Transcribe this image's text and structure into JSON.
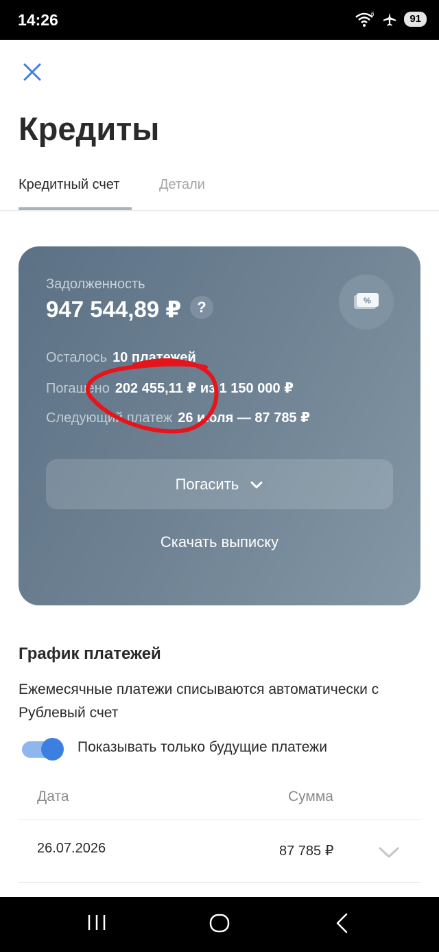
{
  "status_bar": {
    "time": "14:26",
    "battery": "91",
    "wifi_badge": "6"
  },
  "header": {
    "title": "Кредиты"
  },
  "tabs": [
    {
      "label": "Кредитный счет",
      "active": true
    },
    {
      "label": "Детали",
      "active": false
    }
  ],
  "card": {
    "debt_label": "Задолженность",
    "debt_amount": "947 544,89 ₽",
    "help_symbol": "?",
    "rows": [
      {
        "label": "Осталось",
        "value": "10 платежей"
      },
      {
        "label": "Погашено",
        "value": "202 455,11 ₽ из 1 150 000 ₽"
      },
      {
        "label": "Следующий платеж",
        "value": "26 июля — 87 785 ₽"
      }
    ],
    "repay_button": "Погасить",
    "statement_link": "Скачать выписку",
    "icon": "percent-card-icon",
    "colors": {
      "gradient_start": "#5c7185",
      "gradient_end": "#8397a6"
    }
  },
  "schedule": {
    "title": "График платежей",
    "description": "Ежемесячные платежи списываются автоматически с Рублевый счет",
    "toggle_label": "Показывать только будущие платежи",
    "toggle_on": true,
    "columns": {
      "date": "Дата",
      "sum": "Сумма"
    },
    "payments": [
      {
        "date": "26.07.2026",
        "amount": "87 785 ₽"
      }
    ]
  },
  "colors": {
    "accent": "#3d7fe0",
    "annotation": "#e8141b"
  }
}
